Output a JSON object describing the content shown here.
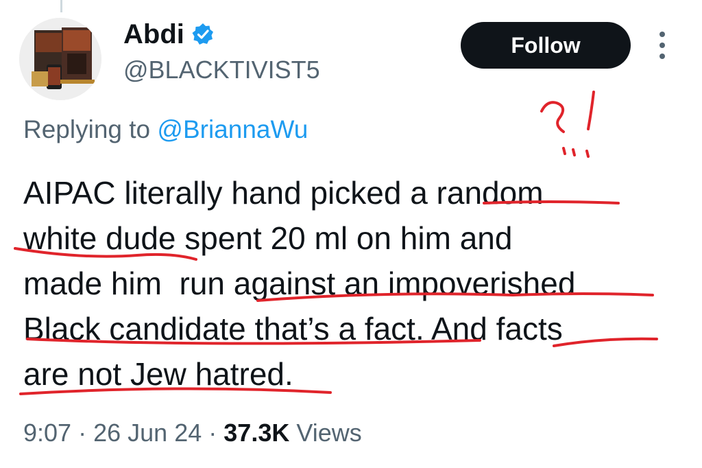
{
  "author": {
    "display_name": "Abdi",
    "handle": "@BLACKTIVIST5",
    "verified": true,
    "avatar_icon": "book-cover-avatar"
  },
  "follow_label": "Follow",
  "reply_context": {
    "prefix": "Replying to",
    "mention": "@BriannaWu"
  },
  "tweet": {
    "lines": [
      "AIPAC literally hand picked a random",
      "white dude spent 20 ml on him and",
      "made him  run against an impoverished",
      "Black candidate that’s a fact. And facts",
      "are not Jew hatred."
    ]
  },
  "annotation": {
    "marks": "?!",
    "color": "#e0242b"
  },
  "meta": {
    "time": "9:07",
    "separator": "·",
    "date": "26 Jun 24",
    "views_count": "37.3K",
    "views_label": "Views"
  },
  "colors": {
    "text": "#0f1419",
    "secondary": "#536471",
    "accent": "#1d9bf0",
    "button_bg": "#0f1419",
    "annotation_red": "#e0242b"
  }
}
